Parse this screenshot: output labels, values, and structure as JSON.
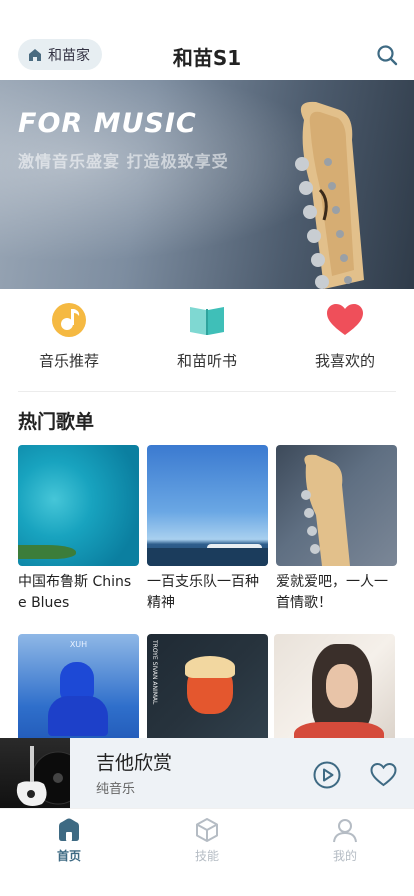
{
  "header": {
    "home_label": "和苗家",
    "title": "和苗S1"
  },
  "banner": {
    "title": "FOR MUSIC",
    "subtitle": "激情音乐盛宴 打造极致享受"
  },
  "quick_menu": [
    {
      "label": "音乐推荐",
      "icon": "music-disc-icon",
      "color": "#f5b942"
    },
    {
      "label": "和苗听书",
      "icon": "open-book-icon",
      "color": "#4fc6c0"
    },
    {
      "label": "我喜欢的",
      "icon": "heart-icon",
      "color": "#ef4f5a"
    }
  ],
  "hot_playlists": {
    "title": "热门歌单",
    "items": [
      {
        "title": "中国布鲁斯 Chinse Blues",
        "cover": "ocean-aerial"
      },
      {
        "title": "一百支乐队一百种精神",
        "cover": "sky-wave"
      },
      {
        "title": "爱就爱吧，一人一首情歌！",
        "cover": "guitar-headstock"
      },
      {
        "title": "",
        "cover": "blue-figure",
        "cover_text": "XUH"
      },
      {
        "title": "",
        "cover": "red-portrait",
        "cover_text": "TROYE SIVAN ANIMAL"
      },
      {
        "title": "",
        "cover": "woman-portrait"
      }
    ]
  },
  "player": {
    "title": "吉他欣赏",
    "subtitle": "纯音乐"
  },
  "tabbar": [
    {
      "label": "首页",
      "icon": "home-icon",
      "active": true
    },
    {
      "label": "技能",
      "icon": "cube-icon",
      "active": false
    },
    {
      "label": "我的",
      "icon": "user-icon",
      "active": false
    }
  ],
  "colors": {
    "accent": "#3e6a83",
    "tab_inactive": "#b5bcc4",
    "player_bg": "#eef2f6"
  }
}
